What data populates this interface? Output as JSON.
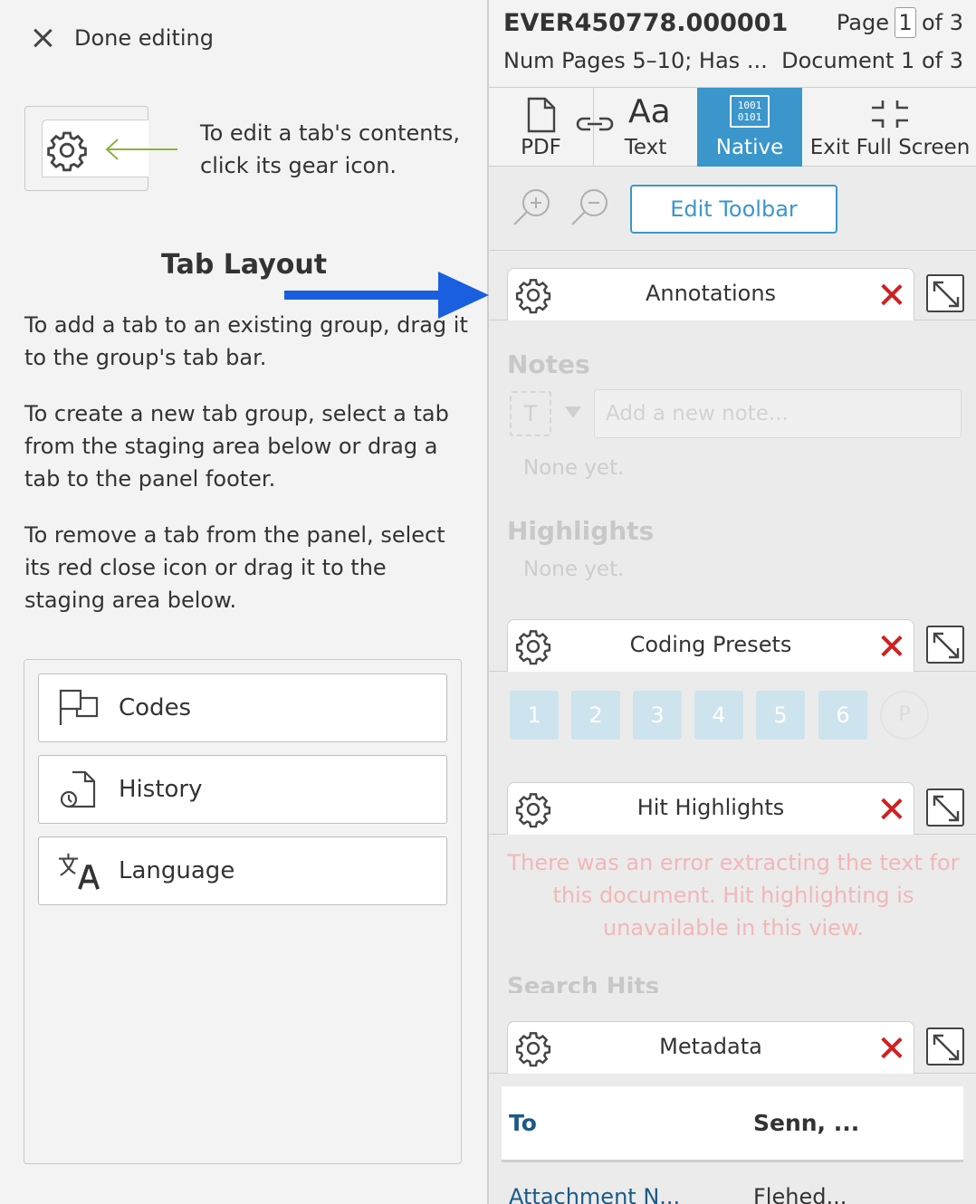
{
  "left": {
    "done_label": "Done editing",
    "edit_hint": "To edit a tab's contents, click its gear icon.",
    "tab_layout_title": "Tab Layout",
    "para1": "To add a tab to an existing group, drag it to the group's tab bar.",
    "para2": "To create a new tab group, select a tab from the staging area below or drag a tab to the panel footer.",
    "para3": "To remove a tab from the panel, select its red close icon or drag it to the staging area below.",
    "staging": [
      {
        "label": "Codes",
        "icon": "codes-flag-icon"
      },
      {
        "label": "History",
        "icon": "history-icon"
      },
      {
        "label": "Language",
        "icon": "language-translate-icon"
      }
    ]
  },
  "header": {
    "doc_id": "EVER450778.000001",
    "doc_meta": "Num Pages 5–10; Has ...",
    "page_label": "Page",
    "page_current": "1",
    "page_of": "of 3",
    "doc_indicator": "Document 1 of 3"
  },
  "viewbar": {
    "pdf": "PDF",
    "text": "Text",
    "native": "Native",
    "exit": "Exit Full Screen",
    "text_glyph": "Aa",
    "native_glyph_top": "1001",
    "native_glyph_bottom": "0101"
  },
  "toolbar": {
    "edit_toolbar": "Edit Toolbar"
  },
  "annotations": {
    "title": "Annotations",
    "notes_label": "Notes",
    "note_type": "T",
    "note_placeholder": "Add a new note...",
    "notes_empty": "None yet.",
    "highlights_label": "Highlights",
    "highlights_empty": "None yet."
  },
  "coding_presets": {
    "title": "Coding Presets",
    "presets": [
      "1",
      "2",
      "3",
      "4",
      "5",
      "6"
    ],
    "p_label": "P"
  },
  "hit_highlights": {
    "title": "Hit Highlights",
    "error": "There was an error extracting the text for this document. Hit highlighting is unavailable in this view.",
    "search_hits": "Search Hits"
  },
  "metadata": {
    "title": "Metadata",
    "row1_key": "To",
    "row1_value": "Senn, ...",
    "row2_key": "Attachment N...",
    "row2_value": "Flehed..."
  },
  "colors": {
    "accent_blue": "#3b96cc",
    "close_red": "#d02020",
    "arrow_blue": "#1a5fe0",
    "hint_arrow_green": "#8ab33a",
    "link_blue": "#1b5a87"
  }
}
